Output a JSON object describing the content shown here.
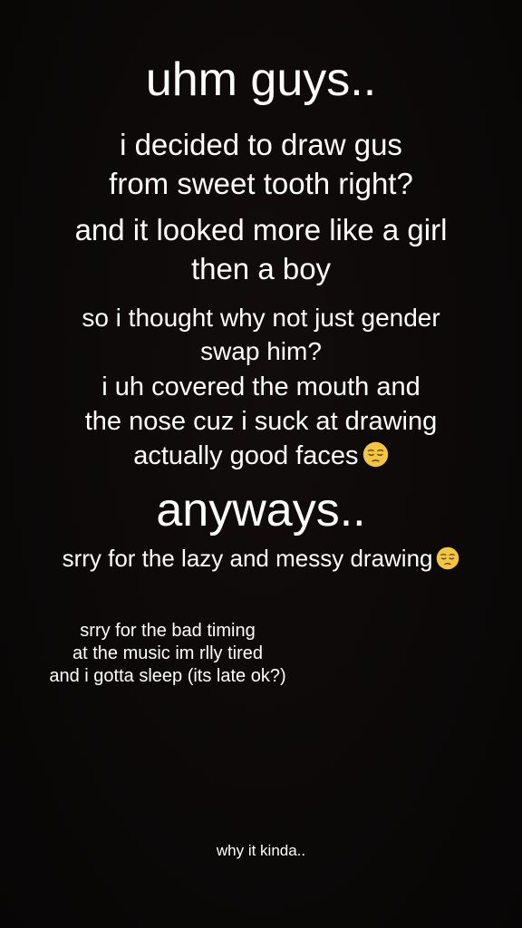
{
  "texts": {
    "title": "uhm guys..",
    "line1": "i decided to draw gus",
    "line2": "from sweet tooth right?",
    "line3": "and it looked more like a girl",
    "line4": "then a boy",
    "line5": "so i thought why not just gender",
    "line6": "swap him?",
    "line7": "i uh covered the mouth and",
    "line8": "the nose cuz i suck at drawing",
    "line9": "actually good faces",
    "heading2": "anyways..",
    "line10": "srry for the lazy and messy drawing",
    "note1": "srry for the bad timing",
    "note2": "at the music im rlly tired",
    "note3": "and i gotta sleep (its late ok?)",
    "footer": "why it kinda.."
  },
  "icons": {
    "emoji": "pensive-face-icon"
  },
  "colors": {
    "background": "#0b0808",
    "text": "#ffffff",
    "emoji_face": "#f4c542"
  }
}
